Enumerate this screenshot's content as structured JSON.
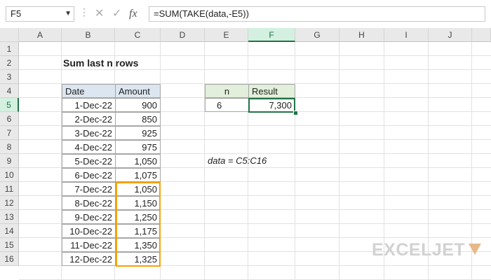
{
  "formula_bar": {
    "name_box": "F5",
    "formula": "=SUM(TAKE(data,-E5))",
    "cancel_icon": "✕",
    "enter_icon": "✓",
    "fx_icon": "fx"
  },
  "columns": [
    "A",
    "B",
    "C",
    "D",
    "E",
    "F",
    "G",
    "H",
    "I",
    "J"
  ],
  "rows": [
    "1",
    "2",
    "3",
    "4",
    "5",
    "6",
    "7",
    "8",
    "9",
    "10",
    "11",
    "12",
    "13",
    "14",
    "15",
    "16"
  ],
  "active": {
    "column": "F",
    "row": "5"
  },
  "sheet": {
    "title": "Sum last n rows",
    "table": {
      "headers": [
        "Date",
        "Amount"
      ],
      "rows": [
        [
          "1-Dec-22",
          "900"
        ],
        [
          "2-Dec-22",
          "850"
        ],
        [
          "3-Dec-22",
          "925"
        ],
        [
          "4-Dec-22",
          "975"
        ],
        [
          "5-Dec-22",
          "1,050"
        ],
        [
          "6-Dec-22",
          "1,075"
        ],
        [
          "7-Dec-22",
          "1,050"
        ],
        [
          "8-Dec-22",
          "1,150"
        ],
        [
          "9-Dec-22",
          "1,250"
        ],
        [
          "10-Dec-22",
          "1,175"
        ],
        [
          "11-Dec-22",
          "1,350"
        ],
        [
          "12-Dec-22",
          "1,325"
        ]
      ]
    },
    "n_table": {
      "headers": [
        "n",
        "Result"
      ],
      "n": "6",
      "result": "7,300"
    },
    "note": "data = C5:C16"
  },
  "logo": "EXCELJET",
  "colors": {
    "accent": "#217346",
    "highlight": "#f0a30a",
    "header_fill": "#dce6f1",
    "result_header_fill": "#e2efda"
  }
}
